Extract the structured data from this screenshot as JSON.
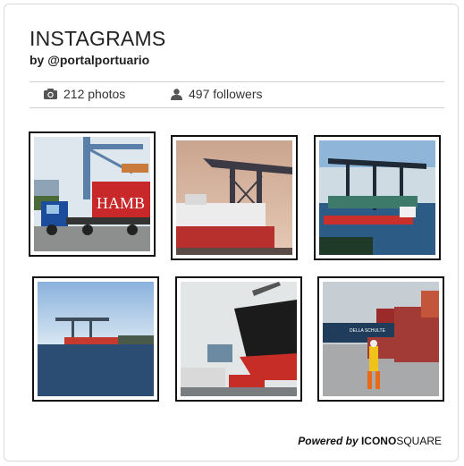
{
  "widget": {
    "title": "INSTAGRAMS",
    "byline": "by @portalportuario"
  },
  "stats": {
    "photos": "212 photos",
    "followers": "497 followers",
    "photos_icon": "camera-icon",
    "followers_icon": "user-icon"
  },
  "photos": [
    {
      "subject": "container-truck-photo",
      "container_text": "HAMB"
    },
    {
      "subject": "cargo-ship-crane-photo"
    },
    {
      "subject": "container-terminal-aerial-photo"
    },
    {
      "subject": "bay-cranes-photo"
    },
    {
      "subject": "ship-bow-photo"
    },
    {
      "subject": "port-worker-photo",
      "ship_text": "DELLA SCHULTE"
    }
  ],
  "footer": {
    "powered_by": "Powered by",
    "brand_part1": "ICONO",
    "brand_part2": "SQUARE"
  },
  "colors": {
    "border": "#d9d9d9",
    "text": "#222222",
    "container_red": "#c8282a",
    "sky_blue": "#8fb6d9",
    "sea_blue": "#2c5b86"
  }
}
